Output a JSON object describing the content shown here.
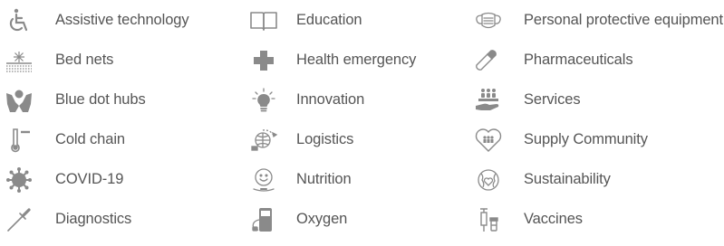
{
  "columns": [
    {
      "items": [
        {
          "label": "Assistive technology",
          "icon": "wheelchair-icon"
        },
        {
          "label": "Bed nets",
          "icon": "bed-net-icon"
        },
        {
          "label": "Blue dot hubs",
          "icon": "blue-dot-hubs-icon"
        },
        {
          "label": "Cold chain",
          "icon": "thermometer-icon"
        },
        {
          "label": "COVID-19",
          "icon": "virus-icon"
        },
        {
          "label": "Diagnostics",
          "icon": "dropper-icon"
        }
      ]
    },
    {
      "items": [
        {
          "label": "Education",
          "icon": "book-icon"
        },
        {
          "label": "Health emergency",
          "icon": "medical-cross-icon"
        },
        {
          "label": "Innovation",
          "icon": "lightbulb-icon"
        },
        {
          "label": "Logistics",
          "icon": "globe-plane-icon"
        },
        {
          "label": "Nutrition",
          "icon": "nutrition-icon"
        },
        {
          "label": "Oxygen",
          "icon": "oxygen-concentrator-icon"
        }
      ]
    },
    {
      "items": [
        {
          "label": "Personal protective equipment",
          "icon": "face-mask-icon"
        },
        {
          "label": "Pharmaceuticals",
          "icon": "capsule-icon"
        },
        {
          "label": "Services",
          "icon": "services-hand-icon"
        },
        {
          "label": "Supply Community",
          "icon": "community-icon"
        },
        {
          "label": "Sustainability",
          "icon": "sustainability-globe-icon"
        },
        {
          "label": "Vaccines",
          "icon": "syringe-vial-icon"
        }
      ]
    }
  ],
  "colors": {
    "icon": "#8a8a8a",
    "text": "#555555"
  }
}
